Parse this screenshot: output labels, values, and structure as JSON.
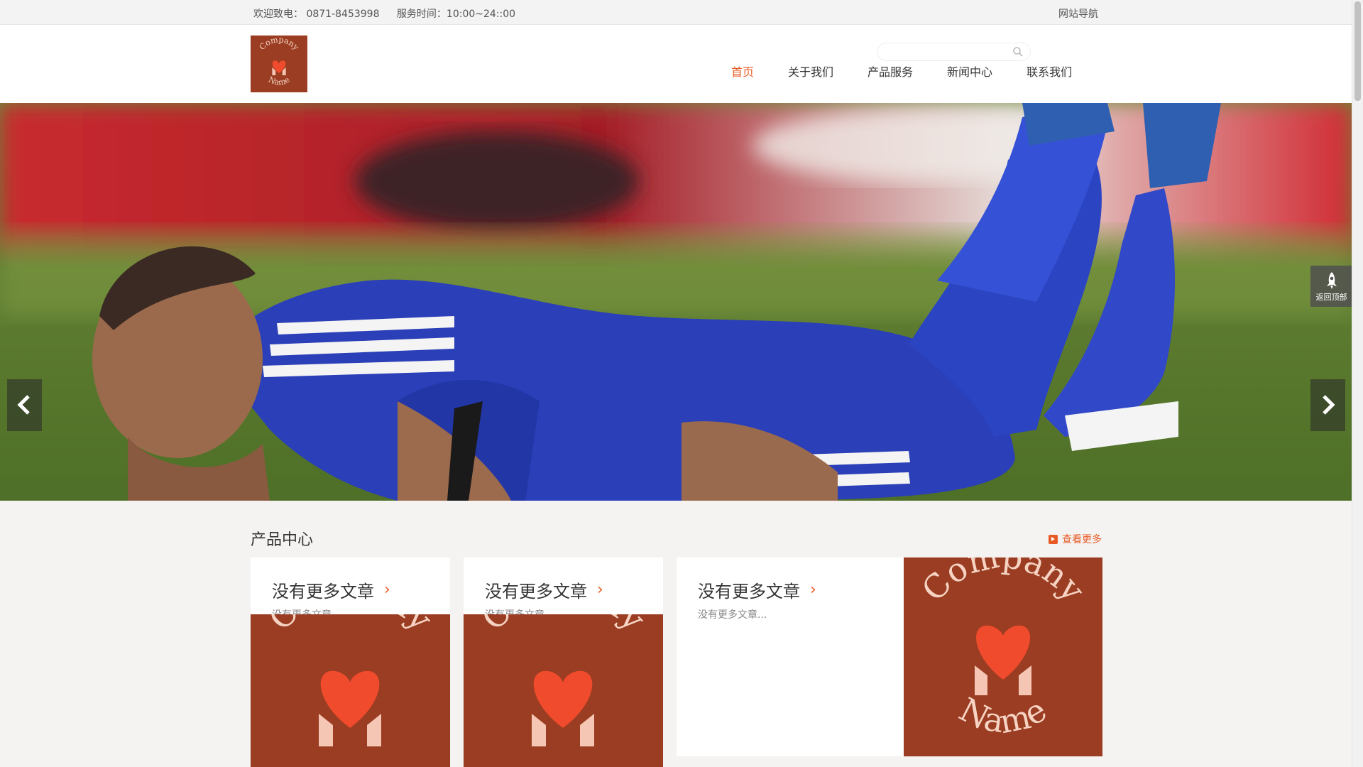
{
  "topbar": {
    "phone": "欢迎致电： 0871-8453998",
    "hours": "服务时间：10:00~24::00",
    "sitemap": "网站导航"
  },
  "header": {
    "logo_text_top": "Company",
    "logo_text_bottom": "Name",
    "search_placeholder": ""
  },
  "nav": {
    "items": [
      "首页",
      "关于我们",
      "产品服务",
      "新闻中心",
      "联系我们"
    ],
    "active": "首页"
  },
  "banner": {
    "slides": 3,
    "active_slide": 1
  },
  "backtop": {
    "label": "返回顶部"
  },
  "products": {
    "title": "产品中心",
    "more": "查看更多",
    "cards": [
      {
        "title": "没有更多文章",
        "desc": "没有更多文章..."
      },
      {
        "title": "没有更多文章",
        "desc": "没有更多文章..."
      },
      {
        "title": "没有更多文章",
        "desc": "没有更多文章..."
      }
    ]
  },
  "colors": {
    "accent": "#e85a25",
    "logo_bg": "#9a3d22",
    "logo_text": "#f6d3c2",
    "heart": "#f04b2c"
  }
}
